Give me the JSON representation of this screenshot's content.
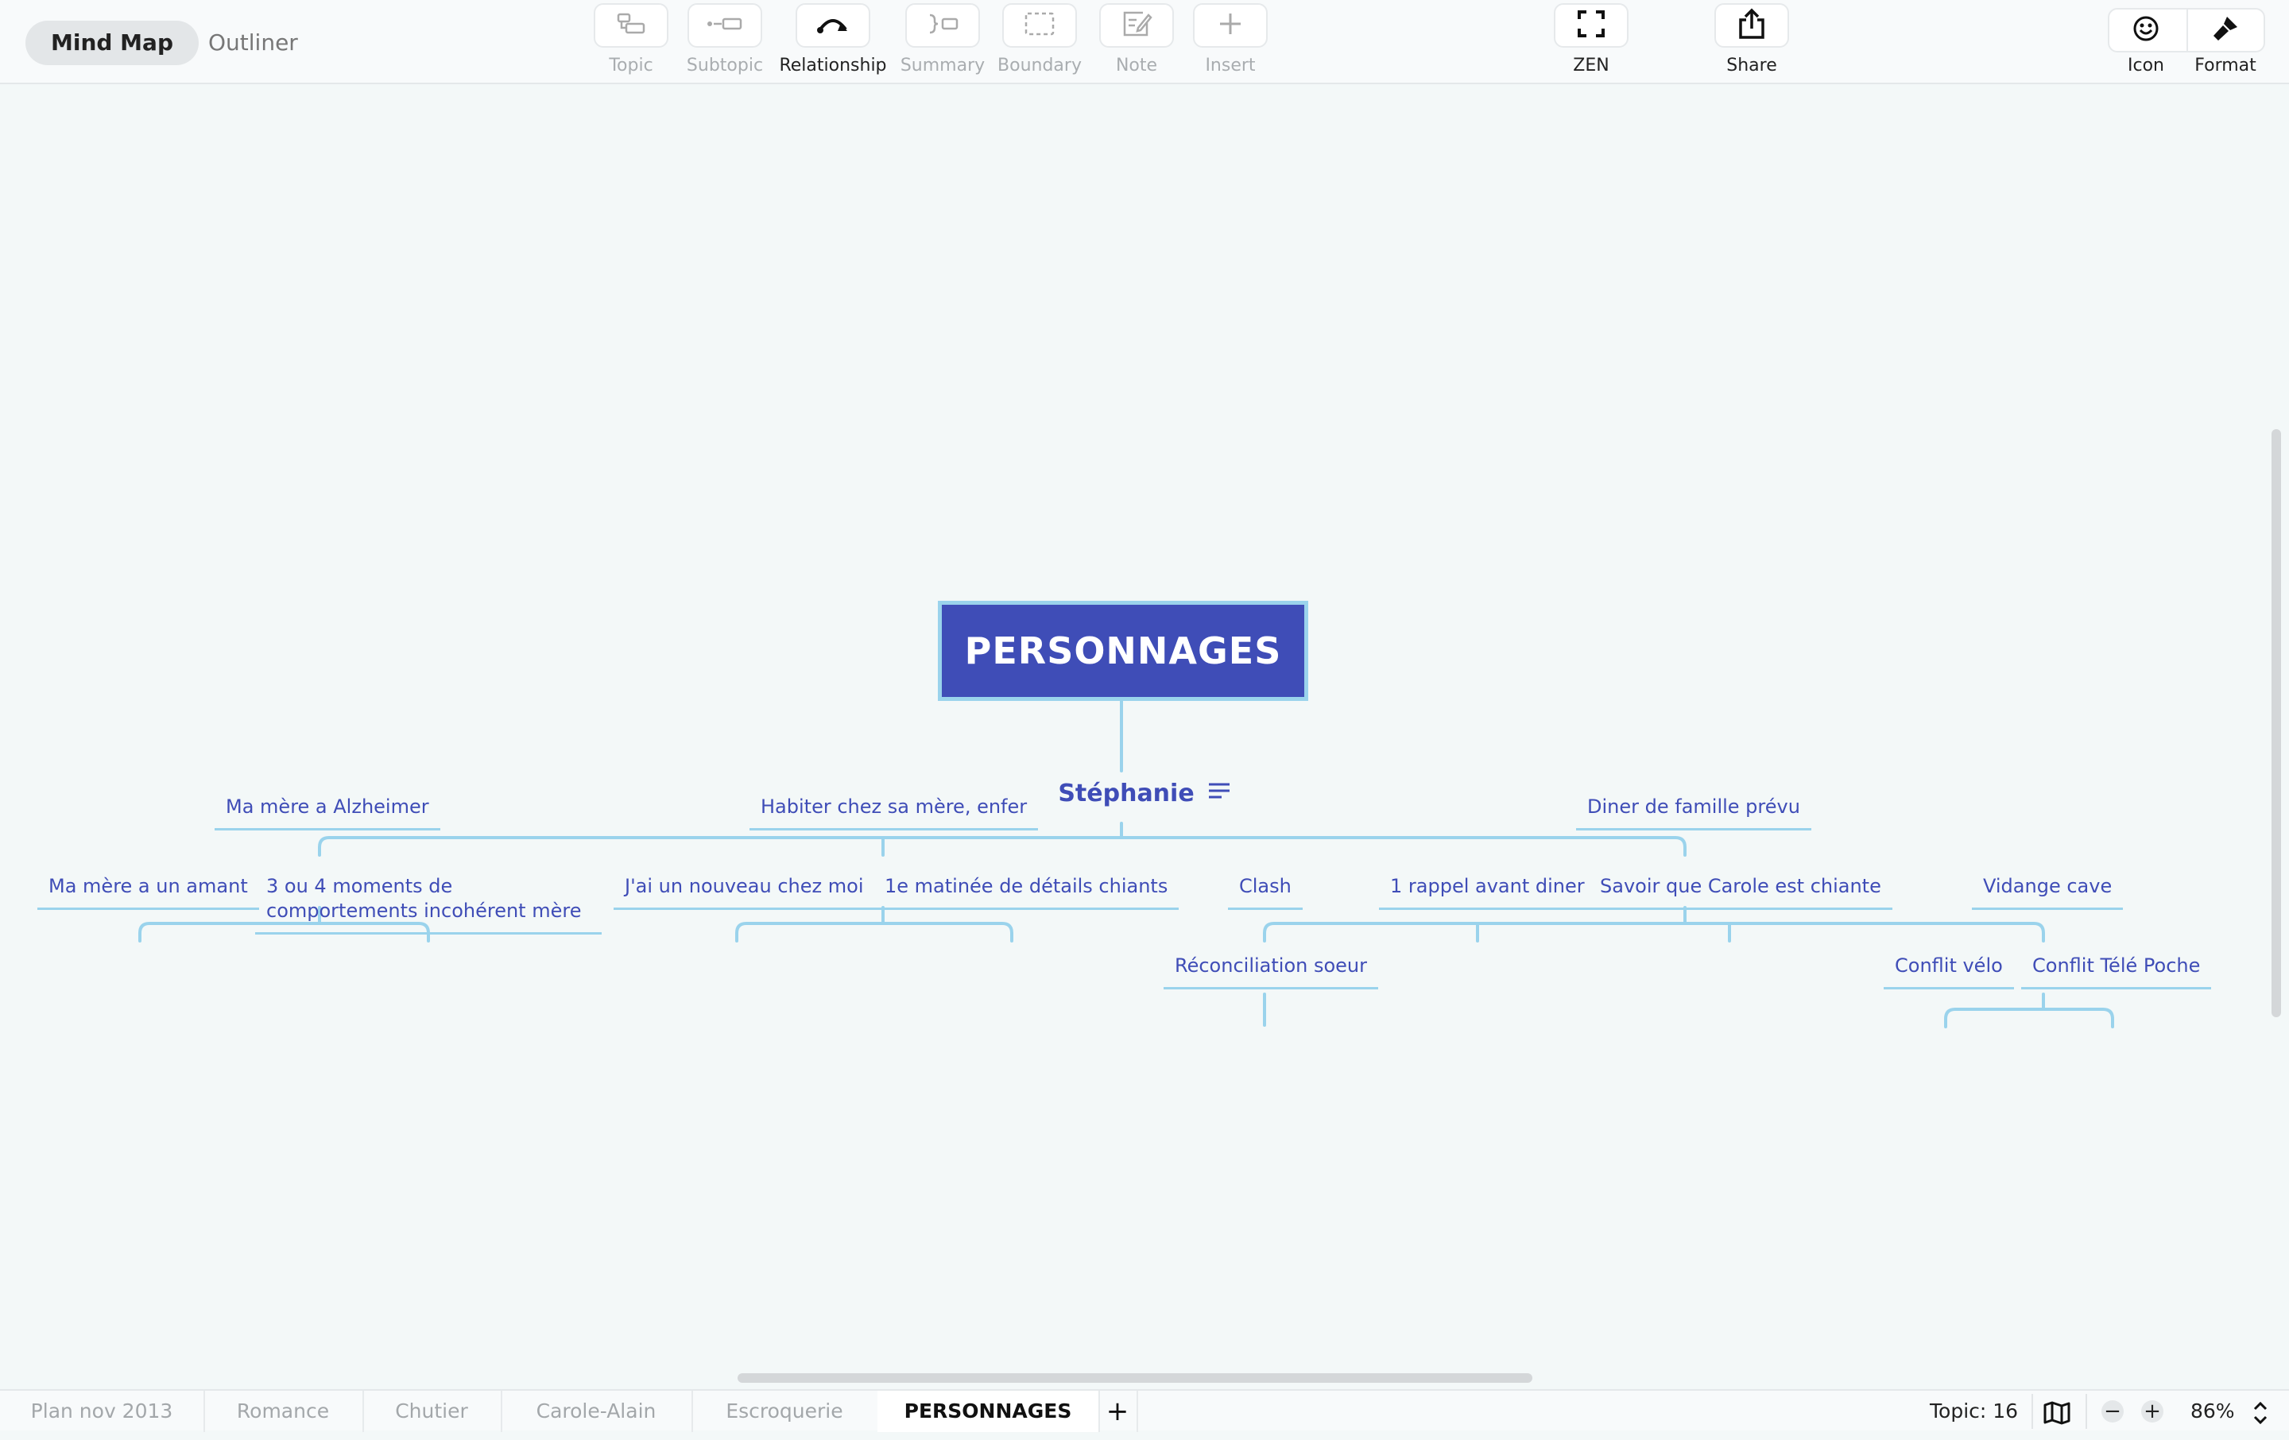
{
  "toolbar": {
    "modes": {
      "mind_map": "Mind Map",
      "outliner": "Outliner"
    },
    "tools": {
      "topic": "Topic",
      "subtopic": "Subtopic",
      "relationship": "Relationship",
      "summary": "Summary",
      "boundary": "Boundary",
      "note": "Note",
      "insert": "Insert"
    },
    "zen": "ZEN",
    "share": "Share",
    "icon": "Icon",
    "format": "Format"
  },
  "map": {
    "root": "PERSONNAGES",
    "main": "Stéphanie",
    "branches": {
      "b1": "Ma mère a Alzheimer",
      "b1_c1": "Ma mère a un amant",
      "b1_c2": "3 ou 4 moments de comportements incohérent mère",
      "b2": "Habiter chez sa mère, enfer",
      "b2_c1": "J'ai un nouveau chez moi",
      "b2_c2": "1e matinée de détails chiants",
      "b3": "Diner de famille prévu",
      "b3_c1": "Clash",
      "b3_c1_c1": "Réconciliation soeur",
      "b3_c2": "1 rappel avant diner",
      "b3_c3": "Savoir que Carole est chiante",
      "b3_c4": "Vidange cave",
      "b3_c4_c1": "Conflit vélo",
      "b3_c4_c2": "Conflit Télé Poche"
    },
    "colors": {
      "root_fill": "#3f4db7",
      "line": "#9ad3ec",
      "text": "#3f4db7"
    }
  },
  "statusbar": {
    "sheets": [
      "Plan nov 2013",
      "Romance",
      "Chutier",
      "Carole-Alain",
      "Escroquerie",
      "PERSONNAGES"
    ],
    "add_sheet": "+",
    "topic_count": "Topic: 16",
    "zoom_out": "−",
    "zoom_in": "+",
    "zoom": "86%"
  },
  "icons": [
    "topic-icon",
    "subtopic-icon",
    "relationship-icon",
    "summary-icon",
    "boundary-icon",
    "note-icon",
    "insert-icon",
    "zen-icon",
    "share-icon",
    "emoji-icon",
    "format-brush-icon",
    "notes-lines-icon",
    "map-icon",
    "zoom-stepper-icon"
  ]
}
